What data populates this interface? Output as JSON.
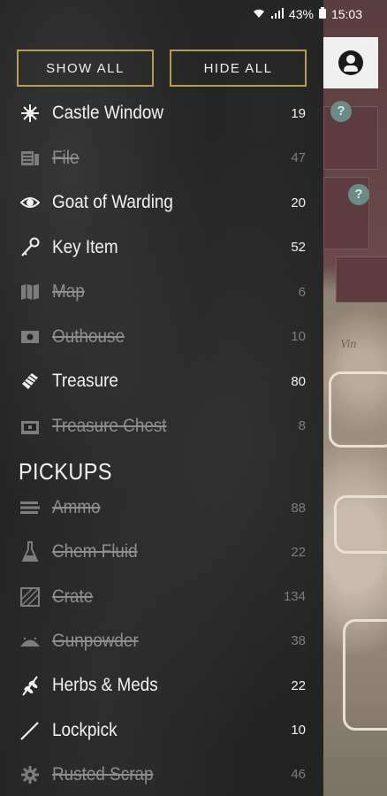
{
  "status_bar": {
    "battery": "43%",
    "time": "15:03"
  },
  "buttons": {
    "show_all": "SHOW ALL",
    "hide_all": "HIDE ALL"
  },
  "map": {
    "label_vin": "Vin",
    "marker_glyph": "?"
  },
  "categories": [
    {
      "label": "Castle Window",
      "count": "19",
      "enabled": true,
      "icon": "starburst-icon"
    },
    {
      "label": "File",
      "count": "47",
      "enabled": false,
      "icon": "file-icon"
    },
    {
      "label": "Goat of Warding",
      "count": "20",
      "enabled": true,
      "icon": "eye-icon"
    },
    {
      "label": "Key Item",
      "count": "52",
      "enabled": true,
      "icon": "key-icon"
    },
    {
      "label": "Map",
      "count": "6",
      "enabled": false,
      "icon": "map-icon"
    },
    {
      "label": "Outhouse",
      "count": "10",
      "enabled": false,
      "icon": "outhouse-icon"
    },
    {
      "label": "Treasure",
      "count": "80",
      "enabled": true,
      "icon": "gem-icon"
    },
    {
      "label": "Treasure Chest",
      "count": "8",
      "enabled": false,
      "icon": "chest-icon"
    }
  ],
  "pickups_heading": "PICKUPS",
  "pickups": [
    {
      "label": "Ammo",
      "count": "88",
      "enabled": false,
      "icon": "ammo-icon"
    },
    {
      "label": "Chem Fluid",
      "count": "22",
      "enabled": false,
      "icon": "flask-icon"
    },
    {
      "label": "Crate",
      "count": "134",
      "enabled": false,
      "icon": "crate-icon"
    },
    {
      "label": "Gunpowder",
      "count": "38",
      "enabled": false,
      "icon": "gunpowder-icon"
    },
    {
      "label": "Herbs & Meds",
      "count": "22",
      "enabled": true,
      "icon": "herb-icon"
    },
    {
      "label": "Lockpick",
      "count": "10",
      "enabled": true,
      "icon": "lockpick-icon"
    },
    {
      "label": "Rusted Scrap",
      "count": "46",
      "enabled": false,
      "icon": "gear-icon"
    }
  ]
}
